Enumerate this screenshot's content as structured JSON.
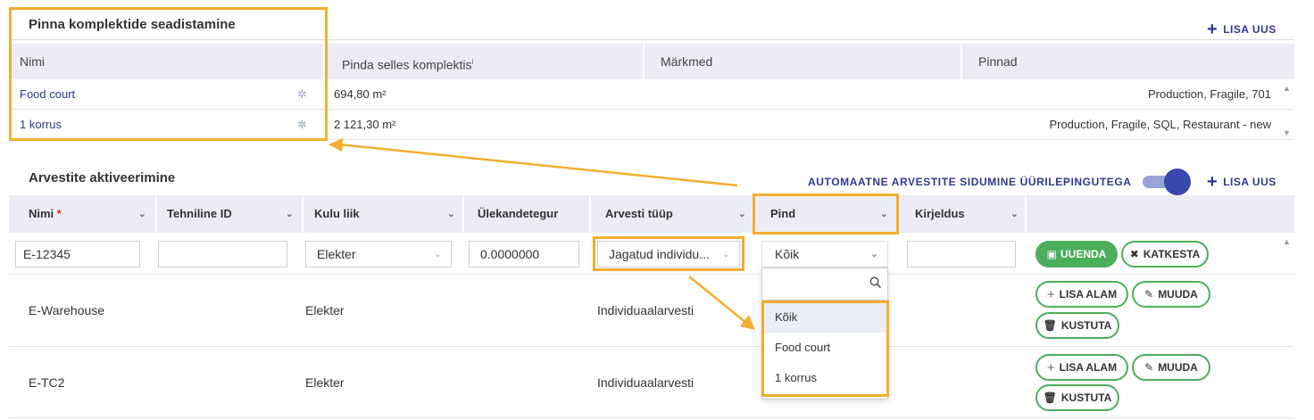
{
  "section1": {
    "title": "Pinna komplektide seadistamine",
    "add_label": "LISA UUS",
    "columns": [
      "Nimi",
      "Pinda selles komplektis",
      "Märkmed",
      "Pinnad"
    ],
    "info_mark": "i",
    "rows": [
      {
        "name": "Food court",
        "area": "694,80 m²",
        "notes": "",
        "surfaces": "Production, Fragile, 701"
      },
      {
        "name": "1 korrus",
        "area": "2 121,30 m²",
        "notes": "",
        "surfaces": "Production, Fragile, SQL, Restaurant - new"
      }
    ]
  },
  "section2": {
    "title": "Arvestite aktiveerimine",
    "auto_link_label": "AUTOMAATNE ARVESTITE SIDUMINE ÜÜRILEPINGUTEGA",
    "auto_link_enabled": true,
    "add_label": "LISA UUS",
    "columns": [
      "Nimi",
      "Tehniline ID",
      "Kulu liik",
      "Ülekandetegur",
      "Arvesti tüüp",
      "Pind",
      "Kirjeldus"
    ],
    "required_mark": "*",
    "edit_row": {
      "name": "E-12345",
      "technical_id": "",
      "cost_type": "Elekter",
      "factor": "0.0000000",
      "meter_type": "Jagatud individu...",
      "area": "Kõik",
      "description": "",
      "save_label": "UUENDA",
      "cancel_label": "KATKESTA"
    },
    "rows": [
      {
        "name": "E-Warehouse",
        "cost_type": "Elekter",
        "meter_type": "Individuaalarvesti"
      },
      {
        "name": "E-TC2",
        "cost_type": "Elekter",
        "meter_type": "Individuaalarvesti"
      }
    ],
    "row_actions": {
      "add_sub": "LISA ALAM",
      "edit": "MUUDA",
      "delete": "KUSTUTA"
    },
    "dropdown": {
      "search_value": "",
      "options": [
        "Kõik",
        "Food court",
        "1 korrus"
      ],
      "selected": "Kõik"
    }
  },
  "colors": {
    "accent": "#2d3a8c",
    "green": "#4cae5c",
    "highlight": "#f2ae2f",
    "header_bg": "#ecedf4"
  }
}
